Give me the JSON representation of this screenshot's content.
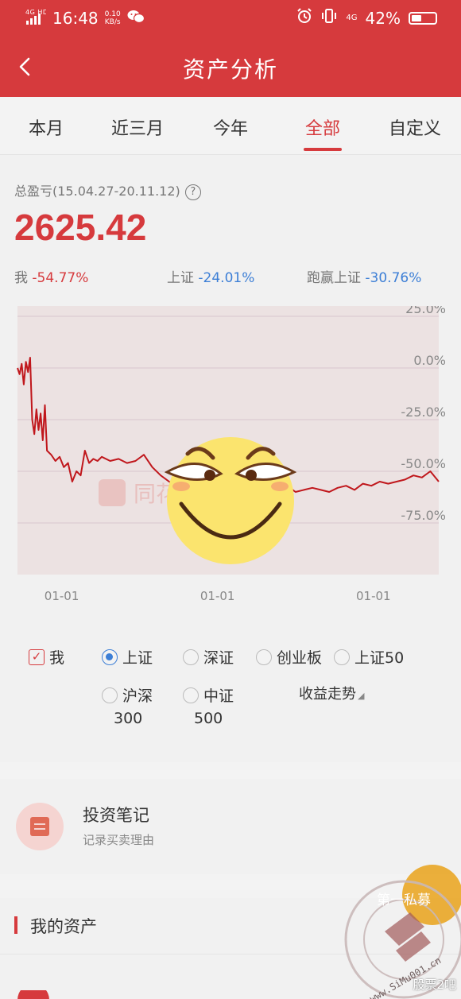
{
  "status_bar": {
    "network": "4G HD",
    "time": "16:48",
    "speed_value": "0.10",
    "speed_unit": "KB/s",
    "network_right": "4G",
    "battery": "42%",
    "battery_level": 0.42
  },
  "header": {
    "title": "资产分析"
  },
  "tabs": [
    {
      "label": "本月",
      "active": false
    },
    {
      "label": "近三月",
      "active": false
    },
    {
      "label": "今年",
      "active": false
    },
    {
      "label": "全部",
      "active": true
    },
    {
      "label": "自定义",
      "active": false
    }
  ],
  "summary": {
    "total_label": "总盈亏(15.04.27-20.11.12)",
    "help_symbol": "?",
    "total_value": "2625.42",
    "me_label": "我",
    "me_value": "-54.77%",
    "sh_label": "上证",
    "sh_value": "-24.01%",
    "beat_label": "跑赢上证",
    "beat_value": "-30.76%"
  },
  "chart_data": {
    "type": "line",
    "y_tick_labels": [
      "25.0%",
      "0.0%",
      "-25.0%",
      "-50.0%",
      "-75.0%"
    ],
    "y_ticks": [
      25,
      0,
      -25,
      -50,
      -75
    ],
    "ylim": [
      -100,
      30
    ],
    "x_tick_labels": [
      "01-01",
      "01-01",
      "01-01"
    ],
    "x_tick_positions": [
      0.12,
      0.49,
      0.86
    ],
    "grid": true,
    "series": [
      {
        "name": "我",
        "color": "#c0171c",
        "x": [
          0.0,
          0.005,
          0.01,
          0.015,
          0.02,
          0.025,
          0.03,
          0.035,
          0.04,
          0.045,
          0.05,
          0.055,
          0.06,
          0.065,
          0.07,
          0.08,
          0.09,
          0.1,
          0.11,
          0.12,
          0.13,
          0.14,
          0.15,
          0.16,
          0.17,
          0.18,
          0.19,
          0.2,
          0.22,
          0.24,
          0.26,
          0.28,
          0.3,
          0.32,
          0.34,
          0.36,
          0.38,
          0.4,
          0.42,
          0.44,
          0.46,
          0.48,
          0.5,
          0.52,
          0.54,
          0.56,
          0.58,
          0.6,
          0.62,
          0.64,
          0.66,
          0.68,
          0.7,
          0.72,
          0.74,
          0.76,
          0.78,
          0.8,
          0.82,
          0.84,
          0.86,
          0.88,
          0.9,
          0.92,
          0.94,
          0.96,
          0.98,
          1.0
        ],
        "y": [
          0,
          -3,
          2,
          -8,
          3,
          -2,
          5,
          -25,
          -32,
          -20,
          -30,
          -22,
          -35,
          -18,
          -40,
          -42,
          -45,
          -43,
          -48,
          -46,
          -55,
          -50,
          -52,
          -40,
          -46,
          -44,
          -45,
          -43,
          -45,
          -44,
          -46,
          -45,
          -42,
          -48,
          -52,
          -55,
          -58,
          -60,
          -62,
          -60,
          -63,
          -61,
          -62,
          -58,
          -60,
          -57,
          -59,
          -56,
          -58,
          -57,
          -60,
          -59,
          -58,
          -59,
          -60,
          -58,
          -57,
          -59,
          -56,
          -57,
          -55,
          -56,
          -55,
          -54,
          -52,
          -53,
          -50,
          -55
        ]
      }
    ]
  },
  "legend": {
    "me": {
      "label": "我",
      "checked": true,
      "check_symbol": "✓"
    },
    "sh": {
      "label": "上证",
      "selected": true
    },
    "sz": {
      "label": "深证",
      "selected": false
    },
    "cyb": {
      "label": "创业板",
      "selected": false
    },
    "sh50": {
      "label": "上证50",
      "selected": false
    },
    "hs300": {
      "label": "沪深",
      "sub": "300",
      "selected": false
    },
    "zz500": {
      "label": "中证",
      "sub": "500",
      "selected": false
    },
    "trend": "收益走势",
    "trend_caret": "◢"
  },
  "notes": {
    "title": "投资笔记",
    "subtitle": "记录买卖理由"
  },
  "assets": {
    "title": "我的资产"
  },
  "watermark": {
    "chart_watermark": "同花顺投资账本",
    "seal_top": "第一私募",
    "seal_url": "www.SiMu001.cn",
    "corner_text": "股票2吧"
  }
}
